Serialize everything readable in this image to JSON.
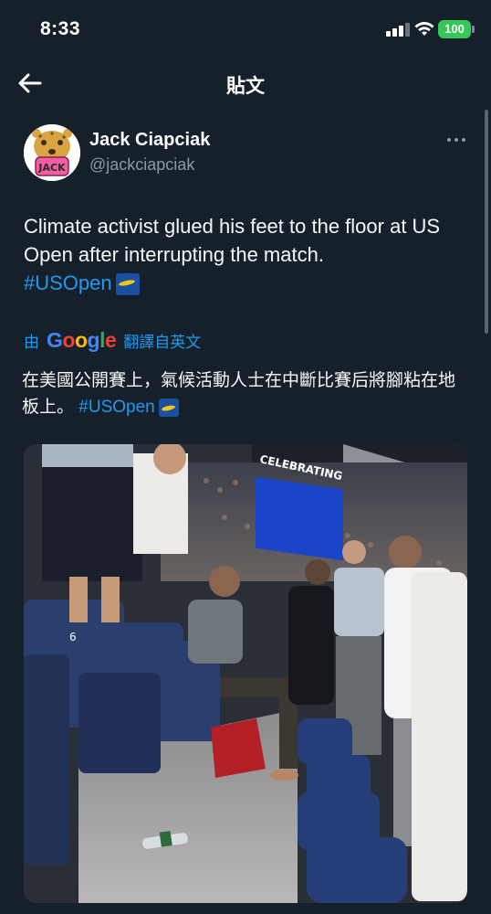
{
  "status_bar": {
    "time": "8:33",
    "battery": "100"
  },
  "header": {
    "title": "貼文"
  },
  "author": {
    "name": "Jack Ciapciak",
    "handle": "@jackciapciak",
    "avatar_text": "JACK"
  },
  "tweet": {
    "text": "Climate activist glued his feet to the floor at US Open after interrupting the match.",
    "hashtag": "#USOpen"
  },
  "translation": {
    "prefix": "由",
    "logo": [
      "G",
      "o",
      "o",
      "g",
      "l",
      "e"
    ],
    "suffix": "翻譯自英文",
    "text": "在美國公開賽上，氣候活動人士在中斷比賽后將腳粘在地板上。",
    "hashtag": "#USOpen"
  },
  "media": {
    "scoreboard_text": "CELEBRATING",
    "seat_number": "6"
  },
  "colors": {
    "background": "#15202b",
    "link": "#1d9bf0",
    "secondary_text": "#8b98a5",
    "battery": "#34c759"
  },
  "icons": [
    "back-arrow-icon",
    "more-options-icon",
    "signal-icon",
    "wifi-icon",
    "battery-icon",
    "us-open-flag-emoji"
  ]
}
